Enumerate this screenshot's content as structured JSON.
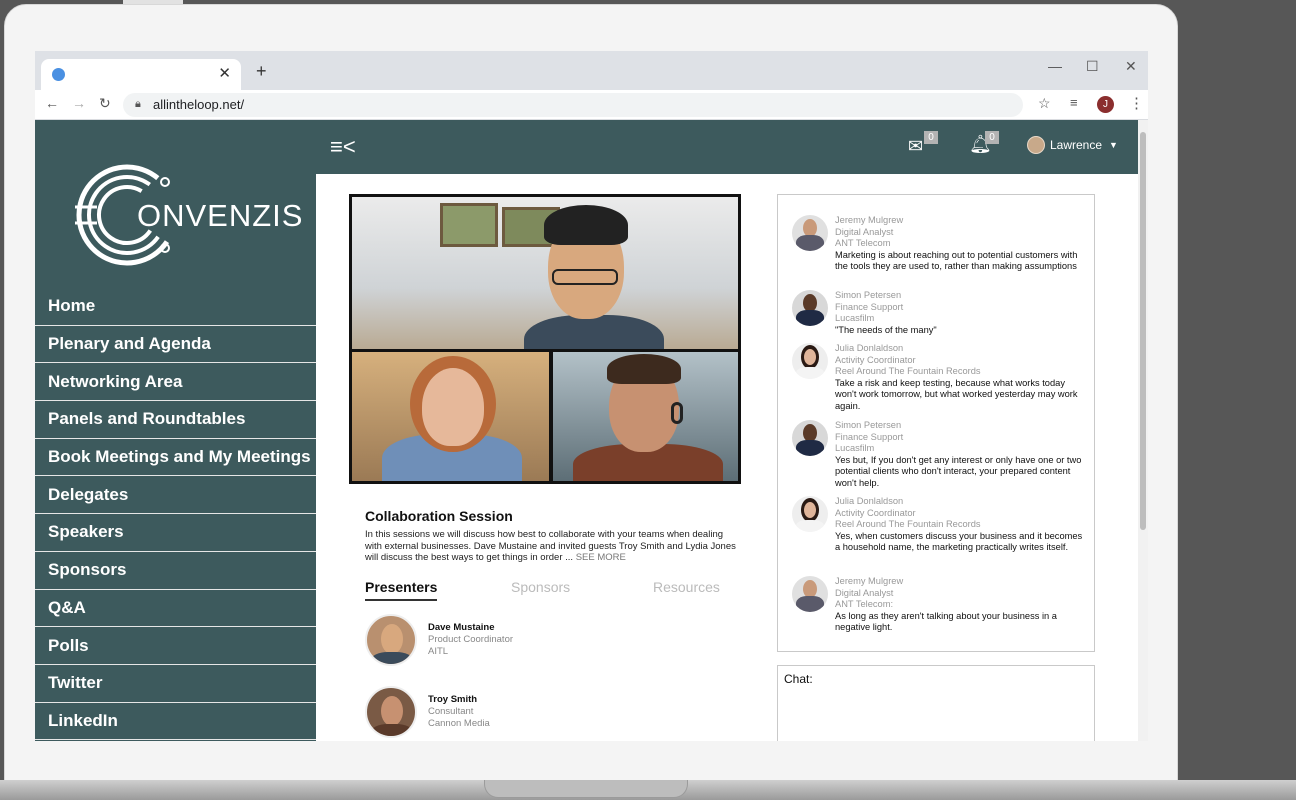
{
  "browser": {
    "url": "allintheloop.net/",
    "profile_initial": "J"
  },
  "brand": {
    "logo_text": "ONVENZIS"
  },
  "sidebar": {
    "items": [
      {
        "label": "Home"
      },
      {
        "label": "Plenary and Agenda"
      },
      {
        "label": "Networking Area"
      },
      {
        "label": "Panels and Roundtables"
      },
      {
        "label": "Book Meetings and My Meetings"
      },
      {
        "label": "Delegates"
      },
      {
        "label": "Speakers"
      },
      {
        "label": "Sponsors"
      },
      {
        "label": "Q&A"
      },
      {
        "label": "Polls"
      },
      {
        "label": "Twitter"
      },
      {
        "label": "LinkedIn"
      }
    ]
  },
  "topbar": {
    "messages_count": "0",
    "notifications_count": "0",
    "user_name": "Lawrence"
  },
  "session": {
    "title": "Collaboration Session",
    "description": "In this sessions we will discuss how best to collaborate with your teams when dealing with external businesses. Dave Mustaine and invited guests Troy Smith and Lydia Jones will discuss the best ways to get things in order ...",
    "see_more": "SEE MORE"
  },
  "tabs": {
    "presenters": "Presenters",
    "sponsors": "Sponsors",
    "resources": "Resources"
  },
  "presenters": [
    {
      "name": "Dave Mustaine",
      "role": "Product Coordinator",
      "org": "AITL"
    },
    {
      "name": "Troy Smith",
      "role": "Consultant",
      "org": "Cannon Media"
    }
  ],
  "chat": {
    "label": "Chat:",
    "messages": [
      {
        "name": "Jeremy Mulgrew",
        "role": "Digital Analyst",
        "org": "ANT Telecom",
        "text": "Marketing is about reaching out to potential customers with the tools they are used to, rather than making assumptions"
      },
      {
        "name": "Simon Petersen",
        "role": "Finance Support",
        "org": "Lucasfilm",
        "text": "\"The needs of the many\""
      },
      {
        "name": "Julia Donlaldson",
        "role": "Activity Coordinator",
        "org": "Reel Around The Fountain Records",
        "text": "Take a risk and keep testing, because what works today won't work tomorrow, but what worked yesterday may work again."
      },
      {
        "name": "Simon Petersen",
        "role": "Finance Support",
        "org": "Lucasfilm",
        "text": "Yes but, If you don't get any interest or only have one or two potential clients who don't interact, your prepared content won't help."
      },
      {
        "name": "Julia Donlaldson",
        "role": "Activity Coordinator",
        "org": "Reel Around The Fountain Records",
        "text": "Yes, when customers discuss your business and it becomes a household name, the marketing practically writes itself."
      },
      {
        "name": "Jeremy Mulgrew",
        "role": "Digital Analyst",
        "org": "ANT Telecom:",
        "text": "As long as they aren't talking about your business in a negative light."
      }
    ]
  }
}
